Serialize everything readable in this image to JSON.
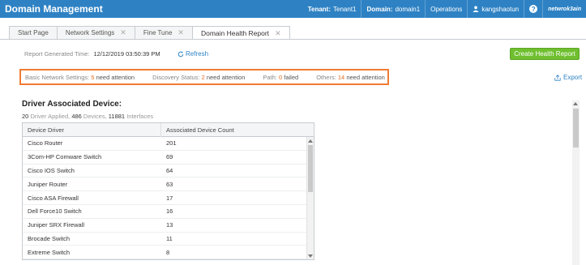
{
  "header": {
    "title": "Domain Management",
    "tenant_label": "Tenant:",
    "tenant_value": "Tenant1",
    "domain_label": "Domain:",
    "domain_value": "domain1",
    "operations": "Operations",
    "user": "kangshaotun",
    "help": "?",
    "logo": "netwrok3ain"
  },
  "tabs": [
    {
      "label": "Start Page"
    },
    {
      "label": "Network Settings"
    },
    {
      "label": "Fine Tune"
    },
    {
      "label": "Domain Health Report"
    }
  ],
  "report": {
    "generated_label": "Report Generated Time:",
    "generated_value": "12/12/2019 03:50:39 PM",
    "refresh": "Refresh",
    "create_button": "Create Health Report",
    "export": "Export"
  },
  "attention": [
    {
      "label": "Basic Network Settings:",
      "count": "5",
      "suffix": "need attention"
    },
    {
      "label": "Discovery Status:",
      "count": "2",
      "suffix": "need attention"
    },
    {
      "label": "Path:",
      "count": "0",
      "suffix": "failed"
    },
    {
      "label": "Others:",
      "count": "14",
      "suffix": "need attention"
    }
  ],
  "driver_section": {
    "title": "Driver Associated Device:",
    "applied_count": "20",
    "applied_label": "Driver Applied,",
    "devices_count": "486",
    "devices_label": "Devices,",
    "interfaces_count": "11881",
    "interfaces_label": "Interfaces",
    "columns": [
      "Device Driver",
      "Associated Device Count"
    ],
    "rows": [
      {
        "driver": "Cisco Router",
        "count": "201"
      },
      {
        "driver": "3Com-HP Comware Switch",
        "count": "69"
      },
      {
        "driver": "Cisco IOS Switch",
        "count": "64"
      },
      {
        "driver": "Juniper Router",
        "count": "63"
      },
      {
        "driver": "Cisco ASA Firewall",
        "count": "17"
      },
      {
        "driver": "Dell Force10 Switch",
        "count": "16"
      },
      {
        "driver": "Juniper SRX Firewall",
        "count": "13"
      },
      {
        "driver": "Brocade Switch",
        "count": "11"
      },
      {
        "driver": "Extreme Switch",
        "count": "8"
      }
    ]
  },
  "colors": {
    "header_bg": "#2e82c4",
    "accent_orange": "#f07b33",
    "button_green": "#6fbf2f",
    "link_blue": "#2e82c4"
  }
}
